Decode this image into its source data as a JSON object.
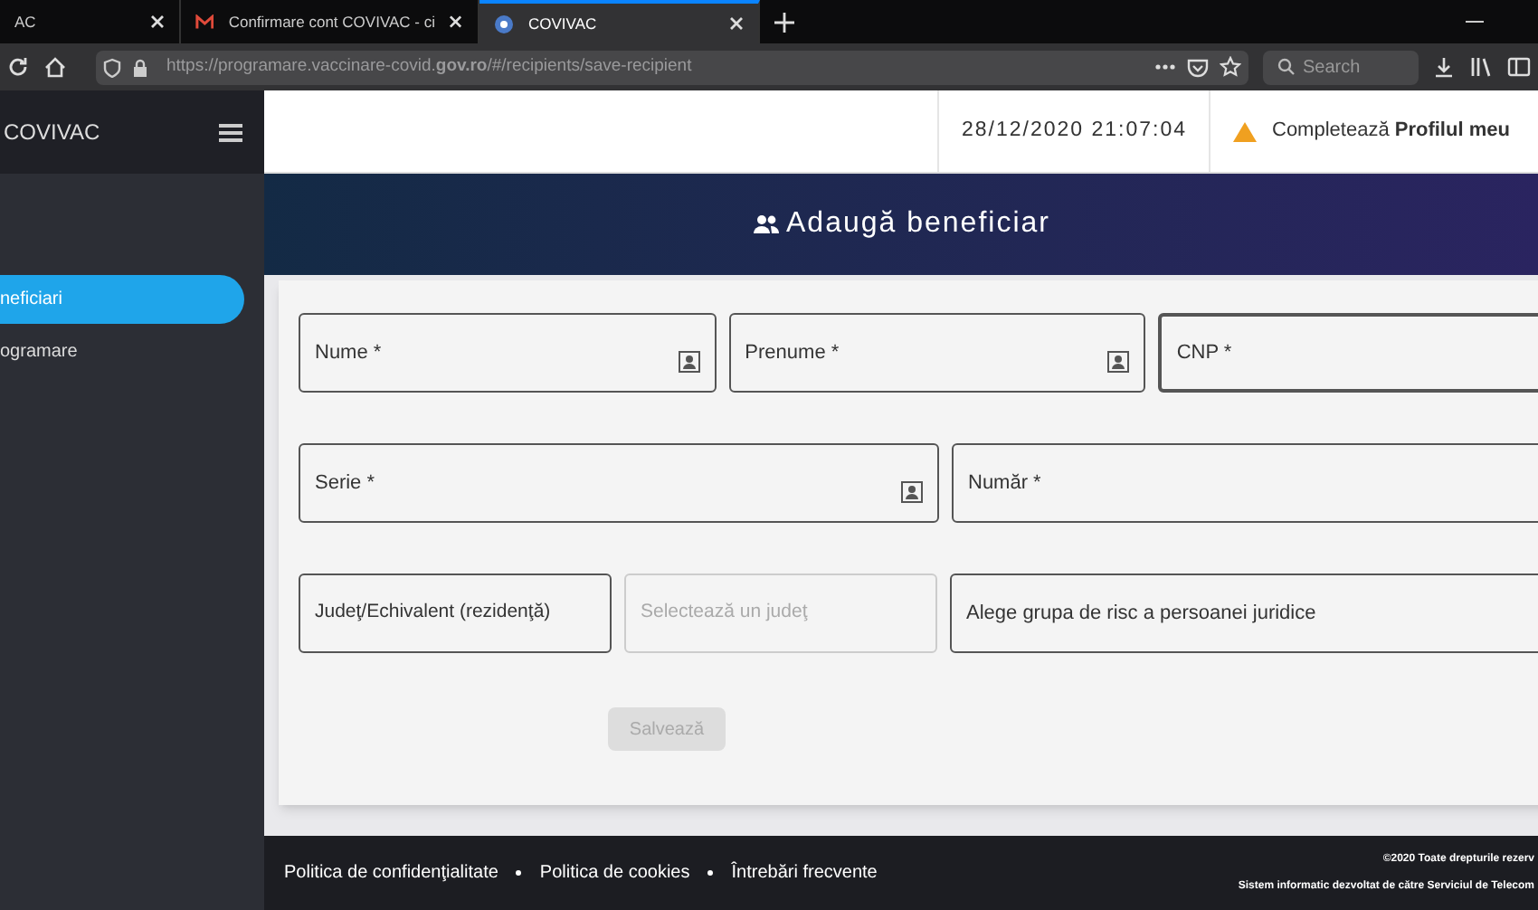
{
  "browser": {
    "tabs": [
      {
        "title": "AC",
        "selected": false,
        "kind": "plain"
      },
      {
        "title": "Confirmare cont COVIVAC - ci",
        "selected": false,
        "kind": "mail"
      },
      {
        "title": "COVIVAC",
        "selected": true,
        "kind": "site"
      }
    ],
    "url": "https://programare.vaccinare-covid.**gov.ro**/#/recipients/save-recipient",
    "search": {
      "placeholder": "Search"
    }
  },
  "sidebar": {
    "brand": "COVIVAC",
    "items": [
      {
        "label": "neficiari",
        "selected": true
      },
      {
        "label": "ogramare",
        "selected": false
      }
    ]
  },
  "header": {
    "datetime": "28/12/2020 21:07:04",
    "notice": "Completează **Profilul meu**"
  },
  "banner": {
    "title": "Adaugă beneficiar"
  },
  "form": {
    "rows": [
      [
        {
          "kind": "input",
          "label": "Nume *",
          "icon": true
        },
        {
          "kind": "input",
          "label": "Prenume *",
          "icon": true
        },
        {
          "kind": "input",
          "label": "CNP *"
        }
      ],
      [
        {
          "kind": "input",
          "label": "Serie *",
          "icon": true
        },
        {
          "kind": "input",
          "label": "Număr *"
        }
      ],
      [
        {
          "kind": "label",
          "label": "Judeţ/Echivalent (rezidenţă)"
        },
        {
          "kind": "select",
          "placeholder": "Selectează un judeţ"
        },
        {
          "kind": "input",
          "label": "Alege grupa de risc a persoanei juridice"
        }
      ]
    ],
    "submit": {
      "label": "Salvează",
      "disabled": true
    }
  },
  "footer": {
    "links": [
      "Politica de confidenţialitate",
      "Politica de cookies",
      "Întrebări frecvente"
    ],
    "copyright": "©2020 Toate drepturile rezerv",
    "credit": "Sistem informatic dezvoltat de către Serviciul de Telecom"
  }
}
